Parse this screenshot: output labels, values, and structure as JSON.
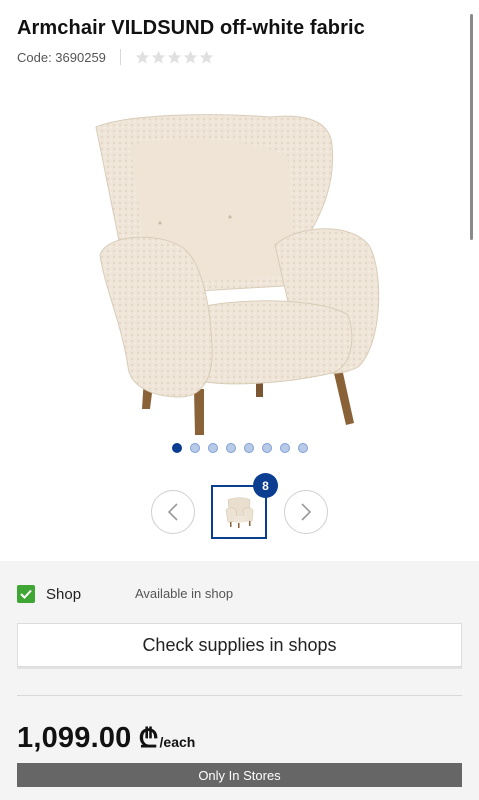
{
  "product": {
    "title": "Armchair VILDSUND off-white fabric",
    "code": "Code: 3690259",
    "rating_stars": 5,
    "rating_filled": 0
  },
  "gallery": {
    "dot_count": 8,
    "active_dot": 0,
    "thumb_count_badge": "8",
    "icons": {
      "prev": "chevron-left-icon",
      "next": "chevron-right-icon"
    }
  },
  "availability": {
    "shop_label": "Shop",
    "shop_status": "Available in shop",
    "check_button": "Check supplies in shops"
  },
  "pricing": {
    "amount": "1,099.00",
    "currency_symbol": "₾",
    "unit": "/each",
    "store_notice": "Only In Stores"
  },
  "colors": {
    "accent": "#0b3d91",
    "check_green": "#3fa535",
    "notice_bar": "#666666"
  }
}
